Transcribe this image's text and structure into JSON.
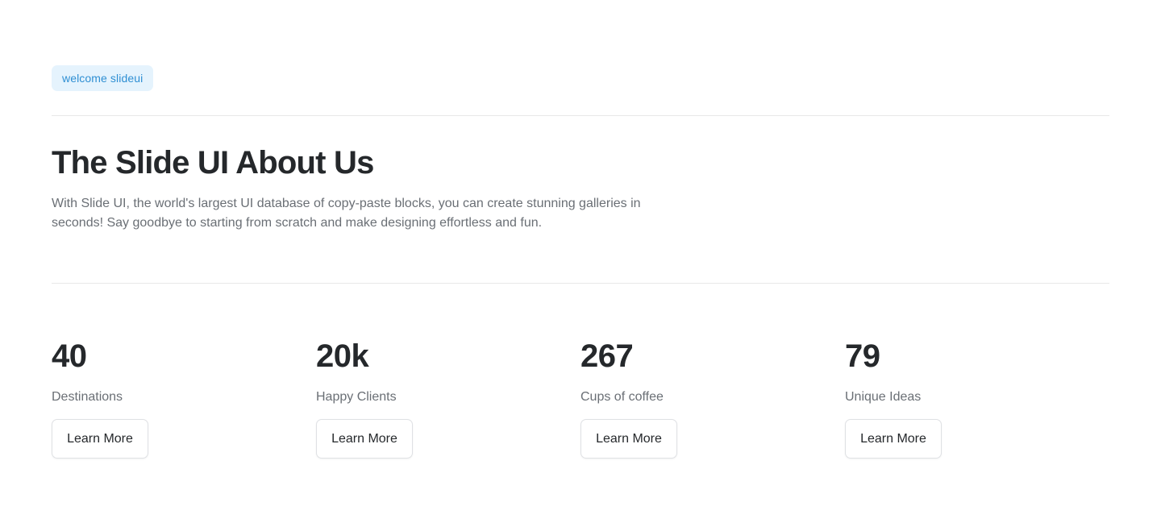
{
  "badge": {
    "label": "welcome slideui"
  },
  "heading": {
    "title": "The Slide UI About Us"
  },
  "description": {
    "text": "With Slide UI, the world's largest UI database of copy-paste blocks, you can create stunning galleries in seconds! Say goodbye to starting from scratch and make designing effortless and fun."
  },
  "stats": [
    {
      "value": "40",
      "label": "Destinations",
      "button_label": "Learn More"
    },
    {
      "value": "20k",
      "label": "Happy Clients",
      "button_label": "Learn More"
    },
    {
      "value": "267",
      "label": "Cups of coffee",
      "button_label": "Learn More"
    },
    {
      "value": "79",
      "label": "Unique Ideas",
      "button_label": "Learn More"
    }
  ],
  "colors": {
    "badge_background": "#e5f3fd",
    "badge_text": "#2f8fd3",
    "heading_text": "#25282b",
    "muted_text": "#6a6f75",
    "divider": "#e8e8e8"
  }
}
